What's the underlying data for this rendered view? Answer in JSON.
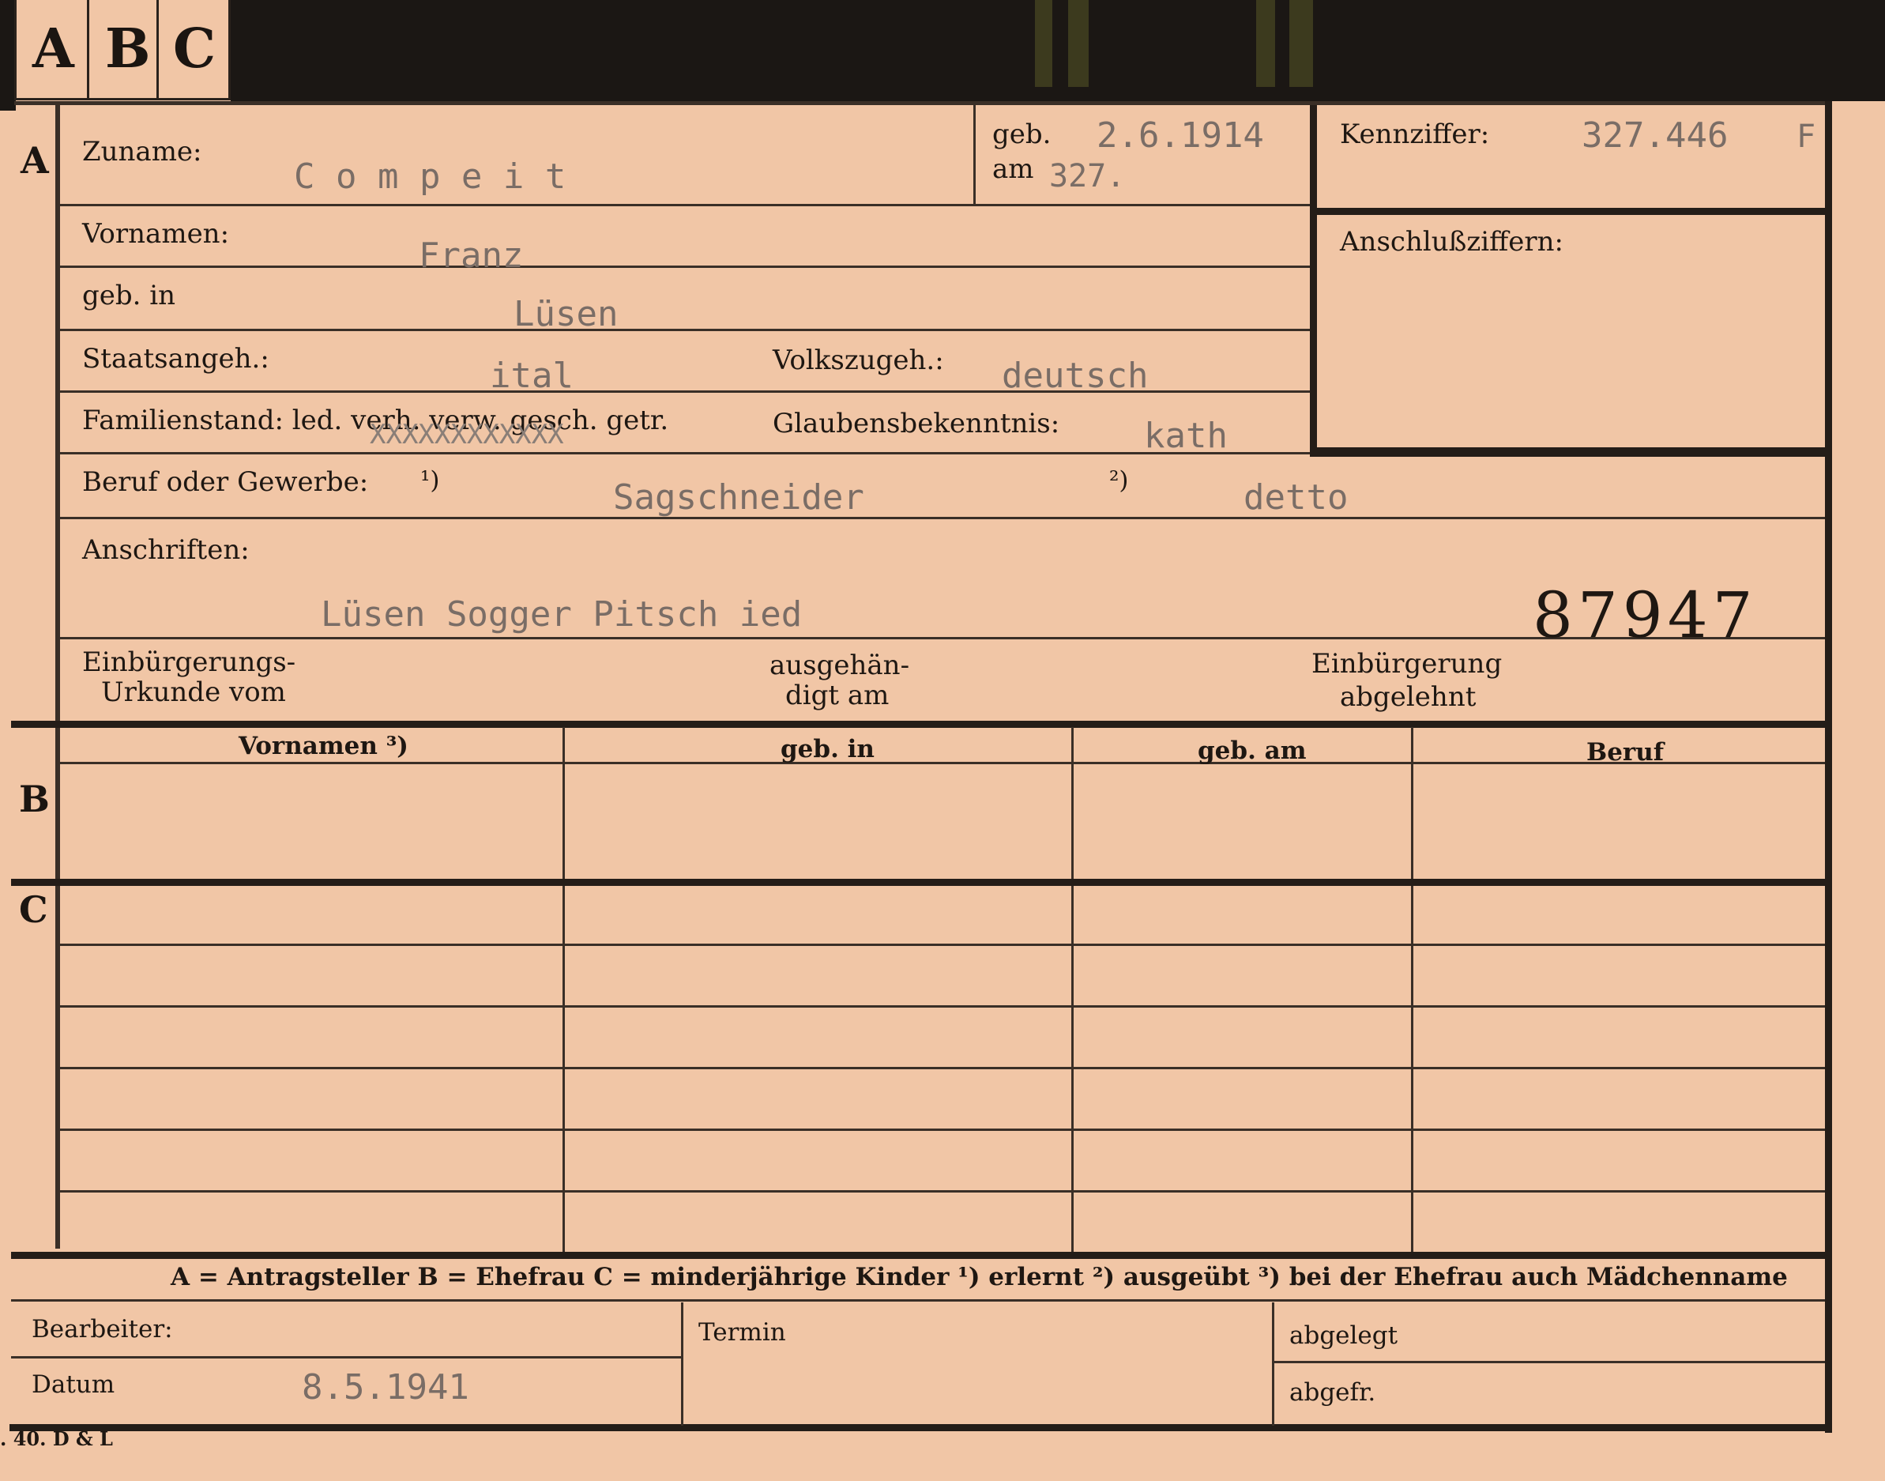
{
  "tabs": [
    "A",
    "B",
    "C"
  ],
  "sections": {
    "a": "A",
    "b": "B",
    "c": "C"
  },
  "labels": {
    "zuname": "Zuname:",
    "geb": "geb.",
    "am": "am",
    "kennziffer": "Kennziffer:",
    "anschlussziffern": "Anschlußziffern:",
    "vornamen": "Vornamen:",
    "geb_in": "geb. in",
    "staatsangeh": "Staatsangeh.:",
    "volkszugeh": "Volkszugeh.:",
    "familienstand": "Familienstand: led. verh. verw. gesch. getr.",
    "glaubensbekenntnis": "Glaubensbekenntnis:",
    "beruf_gewerbe": "Beruf oder Gewerbe:",
    "fn1": "¹)",
    "fn2": "²)",
    "anschriften": "Anschriften:",
    "einbuergerungs1": "Einbürgerungs-",
    "einbuergerungs2": "Urkunde vom",
    "ausgehan1": "ausgehän-",
    "ausgehan2": "digt am",
    "einbuergerung1": "Einbürgerung",
    "einbuergerung2": "abgelehnt",
    "col_vornamen": "Vornamen ³)",
    "col_geb_in": "geb. in",
    "col_geb_am": "geb. am",
    "col_beruf": "Beruf",
    "legend": "A = Antragsteller   B = Ehefrau   C = minderjährige Kinder   ¹) erlernt   ²) ausgeübt   ³) bei der Ehefrau auch Mädchenname",
    "bearbeiter": "Bearbeiter:",
    "termin": "Termin",
    "abgelegt": "abgelegt",
    "datum": "Datum",
    "abgefr": "abgefr.",
    "printer": ". 40. D & L"
  },
  "values": {
    "zuname": "C o m p e i t",
    "geb_date": "2.6.1914",
    "geb_am": "327.",
    "kennziffer": "327.446",
    "kennziffer_suffix": "F",
    "vornamen": "Franz",
    "geb_in": "Lüsen",
    "staatsangeh": "ital",
    "volkszugeh": "deutsch",
    "familienstand_mark": "XXXXXXXXXXXX",
    "glaubensbekenntnis": "kath",
    "beruf1": "Sagschneider",
    "beruf2": "detto",
    "anschrift": "Lüsen Sogger Pitsch ied",
    "stamp_number": "87947",
    "datum": "8.5.1941"
  }
}
